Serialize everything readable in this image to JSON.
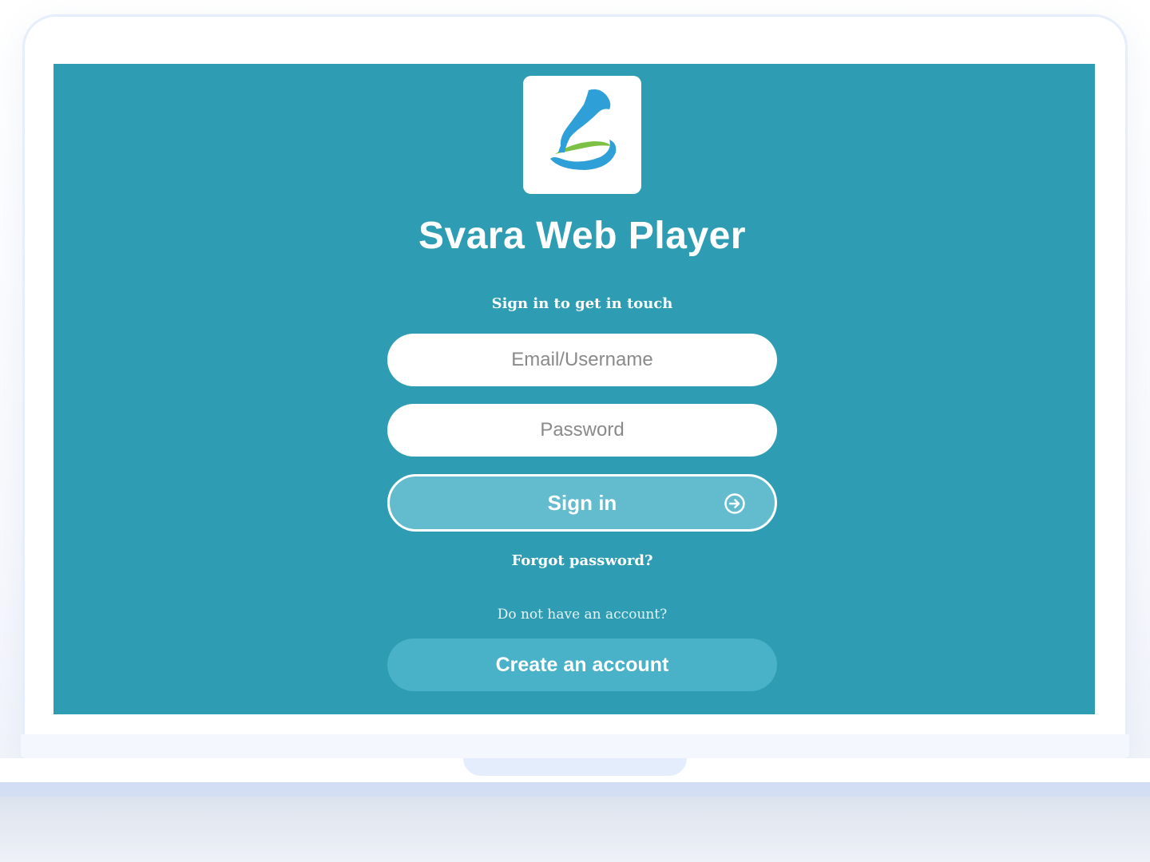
{
  "app": {
    "title": "Svara Web Player",
    "subtitle": "Sign in to get in touch",
    "logo_icon": "svara-logo-icon"
  },
  "login": {
    "email_placeholder": "Email/Username",
    "password_placeholder": "Password",
    "signin_label": "Sign in",
    "signin_icon": "arrow-right-circle-icon",
    "forgot_label": "Forgot password?",
    "no_account_text": "Do not have an account?",
    "create_account_label": "Create an account"
  },
  "colors": {
    "screen_bg": "#2e9db3",
    "signin_bg": "#62bccd",
    "create_bg": "#49b1c8",
    "logo_blue": "#2f9fd8",
    "logo_green": "#7cc146"
  }
}
